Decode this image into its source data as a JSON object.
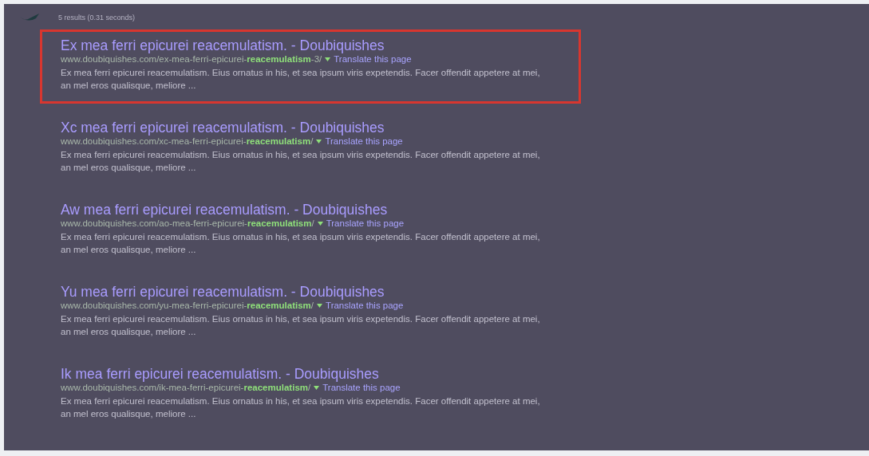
{
  "results_info": "5 results (0.31 seconds)",
  "results": [
    {
      "title": "Ex mea ferri epicurei reacemulatism. - Doubiquishes",
      "url": "www.doubiquishes.com/ex-mea-ferri-epicurei-**reacemulatism**-3/",
      "translate": "Translate this page",
      "snippet": "Ex mea ferri epicurei reacemulatism. Eius ornatus in his, et sea ipsum viris expetendis. Facer offendit appetere at mei, an mel eros qualisque, meliore ...",
      "highlighted": true
    },
    {
      "title": "Xc mea ferri epicurei reacemulatism. - Doubiquishes",
      "url": "www.doubiquishes.com/xc-mea-ferri-epicurei-**reacemulatism**/",
      "translate": "Translate this page",
      "snippet": "Ex mea ferri epicurei reacemulatism. Eius ornatus in his, et sea ipsum viris expetendis. Facer offendit appetere at mei, an mel eros qualisque, meliore ...",
      "highlighted": false
    },
    {
      "title": "Aw mea ferri epicurei reacemulatism. - Doubiquishes",
      "url": "www.doubiquishes.com/ao-mea-ferri-epicurei-**reacemulatism**/",
      "translate": "Translate this page",
      "snippet": "Ex mea ferri epicurei reacemulatism. Eius ornatus in his, et sea ipsum viris expetendis. Facer offendit appetere at mei, an mel eros qualisque, meliore ...",
      "highlighted": false
    },
    {
      "title": "Yu mea ferri epicurei reacemulatism. - Doubiquishes",
      "url": "www.doubiquishes.com/yu-mea-ferri-epicurei-**reacemulatism**/",
      "translate": "Translate this page",
      "snippet": "Ex mea ferri epicurei reacemulatism. Eius ornatus in his, et sea ipsum viris expetendis. Facer offendit appetere at mei, an mel eros qualisque, meliore ...",
      "highlighted": false
    },
    {
      "title": "Ik mea ferri epicurei reacemulatism. - Doubiquishes",
      "url": "www.doubiquishes.com/ik-mea-ferri-epicurei-**reacemulatism**/",
      "translate": "Translate this page",
      "snippet": "Ex mea ferri epicurei reacemulatism. Eius ornatus in his, et sea ipsum viris expetendis. Facer offendit appetere at mei, an mel eros qualisque, meliore ...",
      "highlighted": false
    }
  ]
}
